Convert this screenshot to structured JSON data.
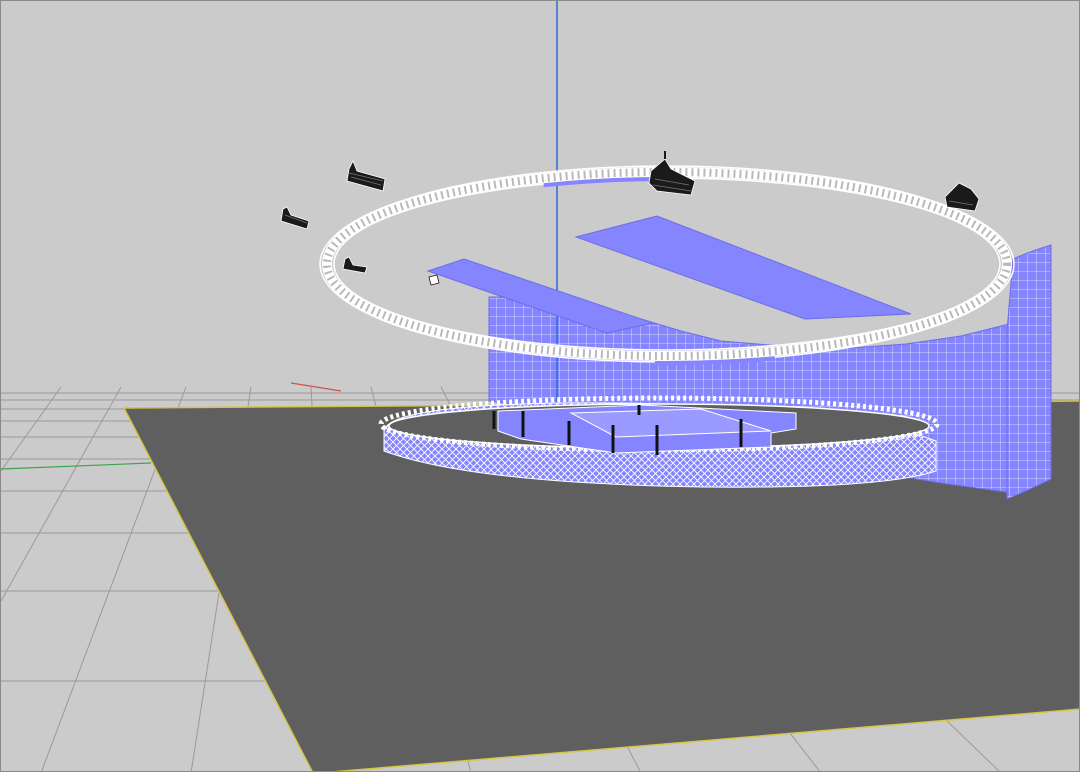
{
  "viewport": {
    "background": "#cbcbcb",
    "grid_line_color": "#9a9a9a",
    "axis_x_color": "#d05050",
    "axis_y_color": "#3fa34d",
    "axis_z_color": "#2e6bd8",
    "ground_plane_color": "#5f5f5f",
    "ground_edge_color": "#d6c447",
    "led_panel_color": "#8585ff",
    "wire_color": "#ffffff",
    "speaker_color": "#1a1a1a"
  },
  "objects": [
    {
      "id": "ground-plane",
      "type": "plane"
    },
    {
      "id": "lower-truss-ring",
      "type": "circular-truss"
    },
    {
      "id": "upper-truss-ring",
      "type": "circular-truss"
    },
    {
      "id": "curved-led-wall",
      "type": "led-screen"
    },
    {
      "id": "ceiling-led-panel-left",
      "type": "led-screen"
    },
    {
      "id": "ceiling-led-panel-right",
      "type": "led-screen"
    },
    {
      "id": "center-stage",
      "type": "stage-platform"
    },
    {
      "id": "speaker-arrays",
      "type": "line-array",
      "count": 6
    }
  ]
}
